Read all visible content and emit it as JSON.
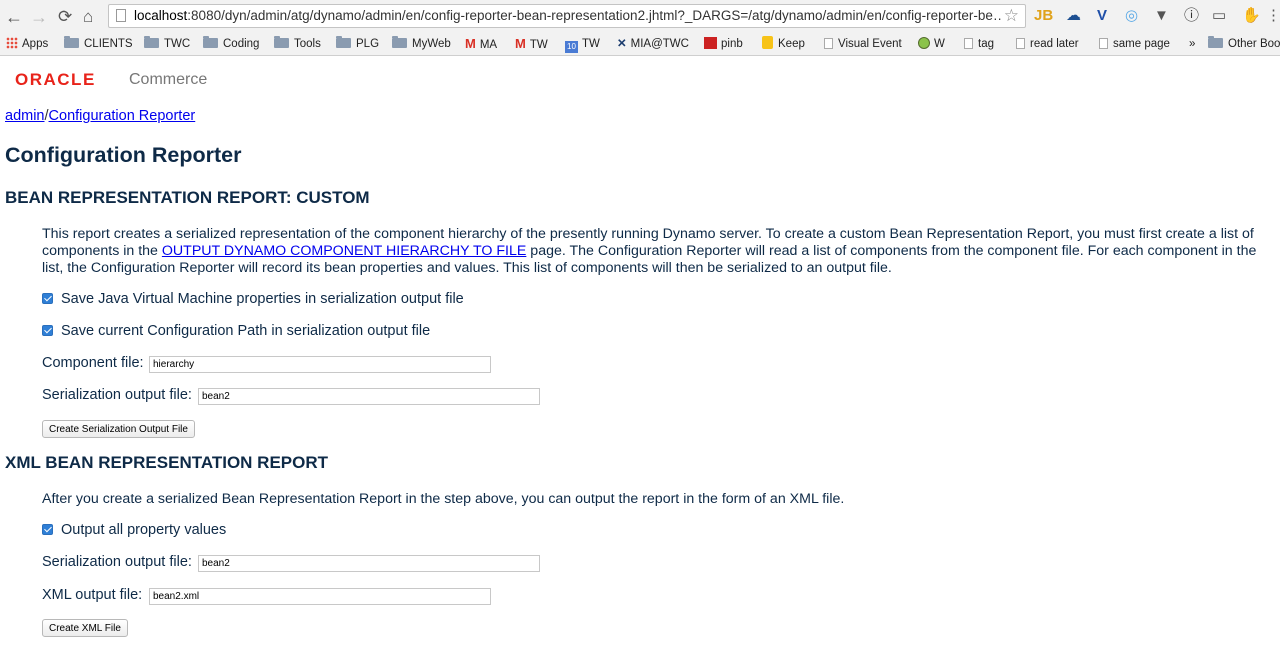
{
  "browser": {
    "url_host": "localhost",
    "url_rest": ":8080/dyn/admin/atg/dynamo/admin/en/config-reporter-bean-representation2.jhtml?_DARGS=/atg/dynamo/admin/en/config-reporter-be…",
    "extensions": [
      "JB",
      "☁",
      "V",
      "◎",
      "▼",
      "ⓘ",
      "▭",
      "✋",
      "⋮"
    ],
    "bookmarks": [
      "Apps",
      "CLIENTS",
      "TWC",
      "Coding",
      "Tools",
      "PLG",
      "MyWeb",
      "MA",
      "TW",
      "TW",
      "MIA@TWC",
      "pinb",
      "Keep",
      "Visual Event",
      "W",
      "tag",
      "read later",
      "same page",
      "»",
      "Other Boo"
    ]
  },
  "logo": {
    "brand": "ORACLE",
    "product": "Commerce"
  },
  "breadcrumb": {
    "root": "admin",
    "sep": "/",
    "current": "Configuration Reporter"
  },
  "page_title": "Configuration Reporter",
  "custom": {
    "heading": "BEAN REPRESENTATION REPORT: CUSTOM",
    "intro_pre": "This report creates a serialized representation of the component hierarchy of the presently running Dynamo server. To create a custom Bean Representation Report, you must first create a list of components in the ",
    "intro_link": "OUTPUT DYNAMO COMPONENT HIERARCHY TO FILE",
    "intro_post": " page. The Configuration Reporter will read a list of components from the component file. For each component in the list, the Configuration Reporter will record its bean properties and values. This list of components will then be serialized to an output file.",
    "chk_jvm": "Save Java Virtual Machine properties in serialization output file",
    "chk_config": "Save current Configuration Path in serialization output file",
    "component_label": "Component file:",
    "component_value": "hierarchy",
    "output_label": "Serialization output file:",
    "output_value": "bean2",
    "button": "Create Serialization Output File"
  },
  "xml": {
    "heading": "XML BEAN REPRESENTATION REPORT",
    "intro": "After you create a serialized Bean Representation Report in the step above, you can output the report in the form of an XML file.",
    "chk_all": "Output all property values",
    "ser_label": "Serialization output file:",
    "ser_value": "bean2",
    "xml_label": "XML output file:",
    "xml_value": "bean2.xml",
    "button": "Create XML File"
  },
  "colors": {
    "heading": "#0e2a47",
    "oracle_red": "#e8231a",
    "link": "#0000ee",
    "checkbox": "#2f7fd6"
  }
}
